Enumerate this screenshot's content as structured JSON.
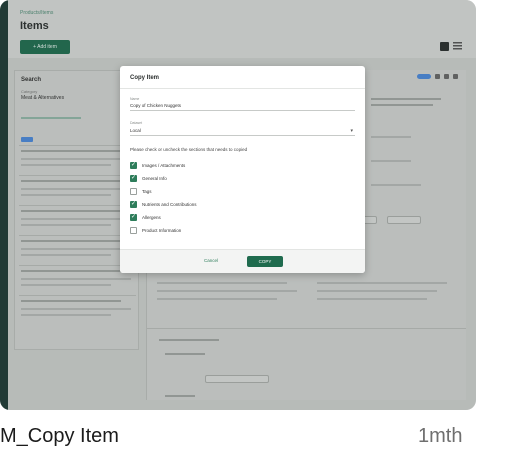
{
  "app": {
    "breadcrumb": "Products/Items",
    "title": "Items",
    "add_button": "+ Add item"
  },
  "left_panel": {
    "title": "Search",
    "category_label": "Category",
    "category_value": "Meat & Alternatives"
  },
  "modal": {
    "title": "Copy Item",
    "name_label": "Name",
    "name_value": "Copy of Chicken Nuggets",
    "dataset_label": "Dataset",
    "dataset_value": "Local",
    "instruction": "Please check or uncheck the sections that needs to copied",
    "options": [
      {
        "label": "Images / Attachments",
        "checked": true
      },
      {
        "label": "General Info",
        "checked": true
      },
      {
        "label": "Tags",
        "checked": false
      },
      {
        "label": "Nutrients and Contributions",
        "checked": true
      },
      {
        "label": "Allergens",
        "checked": true
      },
      {
        "label": "Product Information",
        "checked": false
      }
    ],
    "cancel_label": "Cancel",
    "copy_label": "COPY"
  },
  "caption": {
    "name": "M_Copy Item",
    "age": "1mth"
  },
  "colors": {
    "accent": "#1f6b4e",
    "checkbox": "#2e7d5b"
  }
}
